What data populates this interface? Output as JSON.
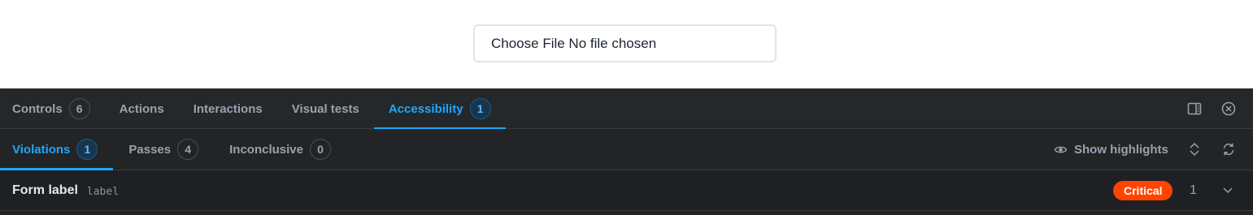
{
  "preview": {
    "file_input_label": "Choose File No file chosen"
  },
  "panel": {
    "tabs": [
      {
        "label": "Controls",
        "badge": "6",
        "active": false
      },
      {
        "label": "Actions",
        "badge": null,
        "active": false
      },
      {
        "label": "Interactions",
        "badge": null,
        "active": false
      },
      {
        "label": "Visual tests",
        "badge": null,
        "active": false
      },
      {
        "label": "Accessibility",
        "badge": "1",
        "active": true
      }
    ],
    "tab_icons": [
      "panel-layout-icon",
      "close-circle-icon"
    ],
    "subtabs": [
      {
        "label": "Violations",
        "badge": "1",
        "active": true
      },
      {
        "label": "Passes",
        "badge": "4",
        "active": false
      },
      {
        "label": "Inconclusive",
        "badge": "0",
        "active": false
      }
    ],
    "show_highlights_label": "Show highlights",
    "subbar_icons": [
      "eye-icon",
      "expand-collapse-icon",
      "refresh-icon"
    ],
    "violation": {
      "name": "Form label",
      "rule_id": "label",
      "impact": "Critical",
      "count": "1"
    }
  },
  "colors": {
    "accent": "#1ea7fd",
    "critical": "#ff4400",
    "panel_bg": "#222426"
  }
}
